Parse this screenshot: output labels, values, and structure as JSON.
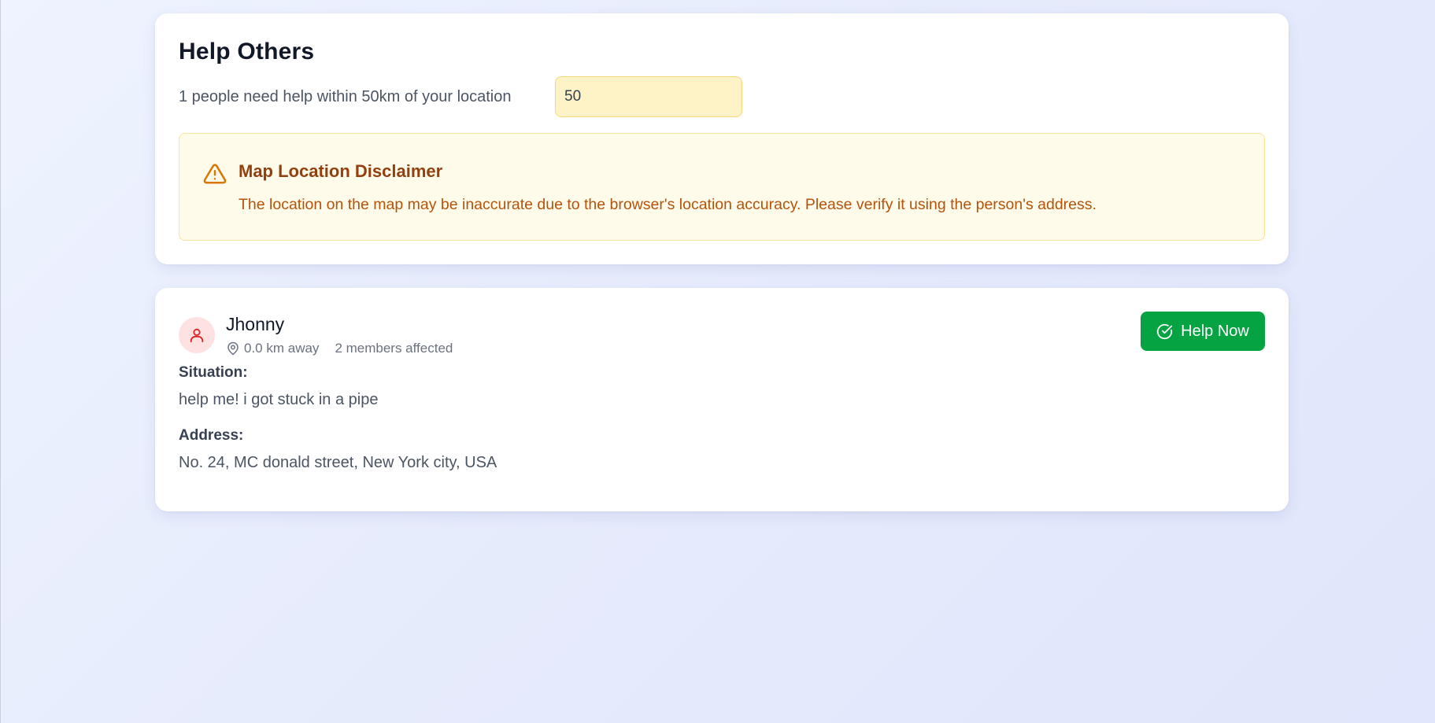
{
  "header": {
    "title": "Help Others",
    "subtitle": "1 people need help within 50km of your location",
    "radius_value": "50"
  },
  "disclaimer": {
    "icon": "warning-triangle-icon",
    "title": "Map Location Disclaimer",
    "text": "The location on the map may be inaccurate due to the browser's location accuracy. Please verify it using the person's address."
  },
  "requests": [
    {
      "name": "Jhonny",
      "avatar_icon": "user-icon",
      "distance": "0.0 km away",
      "members": "2 members affected",
      "help_button_label": "Help Now",
      "situation_label": "Situation:",
      "situation": "help me! i got stuck in a pipe",
      "address_label": "Address:",
      "address": "No. 24, MC donald street, New York city, USA"
    }
  ],
  "colors": {
    "help_button": "#05a342",
    "disclaimer_bg": "#fffbeb",
    "disclaimer_title": "#92400e",
    "disclaimer_text": "#b45309",
    "input_bg": "#fef3c7",
    "avatar_bg": "#fee2e2",
    "avatar_icon": "#dc2626"
  }
}
